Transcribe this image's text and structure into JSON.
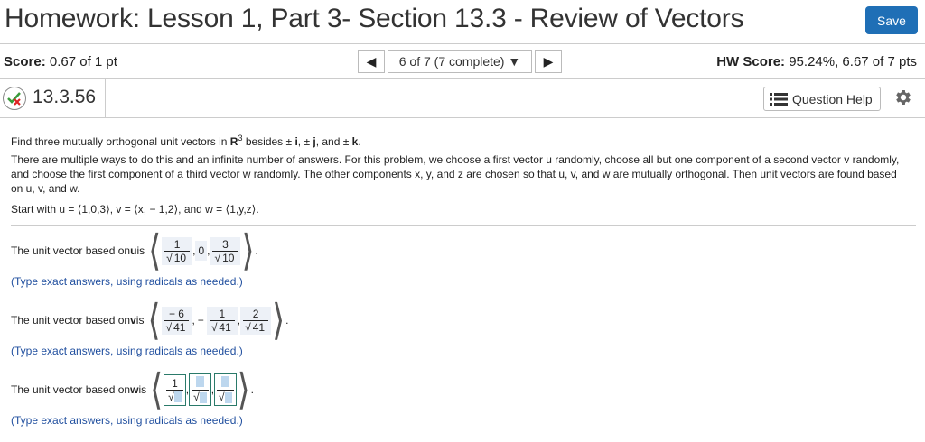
{
  "header": {
    "title": "Homework: Lesson 1, Part 3- Section 13.3 - Review of Vectors",
    "save_label": "Save"
  },
  "score_bar": {
    "score_label": "Score:",
    "score_value": "0.67 of 1 pt",
    "nav_prev": "◀",
    "nav_select": "6 of 7 (7 complete) ▼",
    "nav_next": "▶",
    "hw_label": "HW Score:",
    "hw_value": "95.24%, 6.67 of 7 pts"
  },
  "question_bar": {
    "question_id": "13.3.56",
    "help_label": "Question Help"
  },
  "problem": {
    "p1_a": "Find three mutually orthogonal unit vectors in ",
    "p1_R": "R",
    "p1_exp": "3",
    "p1_b": " besides ± ",
    "p1_i": "i",
    "p1_c": ", ± ",
    "p1_j": "j",
    "p1_d": ", and ± ",
    "p1_k": "k",
    "p1_e": ".",
    "p2": "There are multiple ways to do this and an infinite number of answers.  For this problem, we choose a first vector u randomly, choose all but one component of a second vector v randomly, and choose the first component of a third vector w randomly. The other components x, y, and z are chosen so that u, v, and w are mutually orthogonal. Then unit vectors are found based on u, v, and w.",
    "p3": "Start with u = ⟨1,0,3⟩, v = ⟨x, − 1,2⟩, and w = ⟨1,y,z⟩."
  },
  "answers": {
    "u_label_a": "The unit vector based on ",
    "u_bold": "u",
    "u_label_b": " is",
    "u_c1_num": "1",
    "u_c1_den": "10",
    "u_c2": "0",
    "u_c3_num": "3",
    "u_c3_den": "10",
    "v_label_a": "The unit vector based on ",
    "v_bold": "v",
    "v_label_b": " is",
    "v_c1_num": "− 6",
    "v_c1_den": "41",
    "v_c2_sign": "−",
    "v_c2_num": "1",
    "v_c2_den": "41",
    "v_c3_num": "2",
    "v_c3_den": "41",
    "w_label_a": "The unit vector based on ",
    "w_bold": "w",
    "w_label_b": " is",
    "w_c1_num": "1",
    "hint": "(Type exact answers, using radicals as needed.)",
    "comma": ",",
    "period": "."
  },
  "icons": {
    "status": "partial-correct-icon",
    "help": "list-icon",
    "settings": "gear-icon"
  },
  "colors": {
    "accent": "#1f6fb6",
    "hint": "#1f4e9e",
    "answer_bg": "#edf1f7",
    "input_border": "#2a7a6a"
  }
}
